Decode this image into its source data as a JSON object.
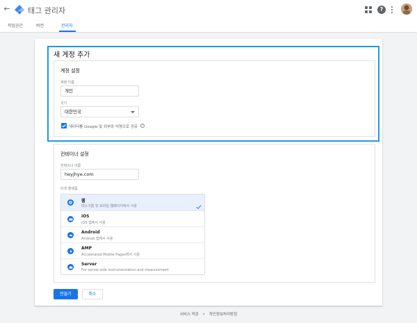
{
  "app": {
    "title": "태그 관리자"
  },
  "tabs": [
    "작업공간",
    "버전",
    "관리자"
  ],
  "card": {
    "title": "새 계정 추가"
  },
  "account": {
    "section_title": "계정 설정",
    "name_label": "계정 이름",
    "name_value": "개인",
    "country_label": "국가",
    "country_value": "대한민국",
    "share_label": "데이터를 Google 및 외부와 익명으로 공유",
    "share_checked": true
  },
  "container": {
    "section_title": "컨테이너 설정",
    "name_label": "컨테이너 이름",
    "name_value": "heyjhye.com",
    "platform_label": "타겟 플랫폼",
    "selected_platform": "웹",
    "platforms": [
      {
        "name": "웹",
        "desc": "데스크톱 및 모바일 웹페이지에서 사용",
        "icon": "web-icon"
      },
      {
        "name": "iOS",
        "desc": "iOS 앱에서 사용",
        "icon": "ios-icon"
      },
      {
        "name": "Android",
        "desc": "Android 앱에서 사용",
        "icon": "android-icon"
      },
      {
        "name": "AMP",
        "desc": "Accelerated Mobile Pages에서 사용",
        "icon": "amp-icon"
      },
      {
        "name": "Server",
        "desc": "For server-side instrumentation and measurement",
        "icon": "server-icon"
      }
    ]
  },
  "buttons": {
    "create": "만들기",
    "cancel": "취소"
  },
  "footer": {
    "terms": "서비스 약관",
    "separator": "•",
    "privacy": "개인정보처리방침"
  },
  "colors": {
    "accent": "#1a73e8",
    "highlight_border": "#1a9be3",
    "page_bg": "#f1f3f4"
  }
}
